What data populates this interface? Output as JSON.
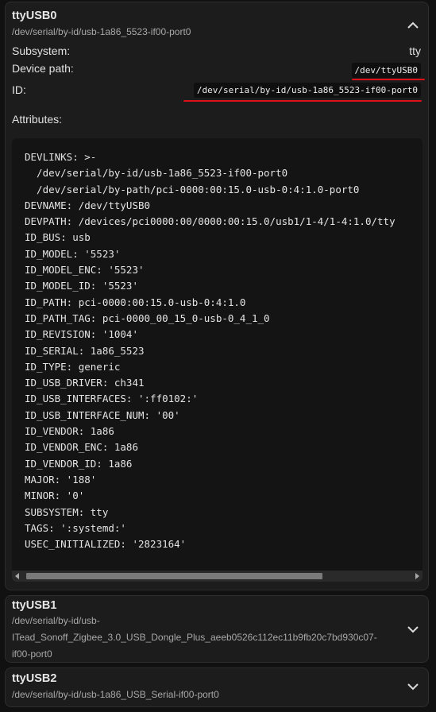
{
  "devices": [
    {
      "title": "ttyUSB0",
      "subtitle": "/dev/serial/by-id/usb-1a86_5523-if00-port0",
      "expanded": true,
      "icon": "chevron-up-icon",
      "subsystem_label": "Subsystem:",
      "subsystem_value": "tty",
      "device_path_label": "Device path:",
      "device_path_value": "/dev/ttyUSB0",
      "id_label": "ID:",
      "id_value": "/dev/serial/by-id/usb-1a86_5523-if00-port0",
      "attributes_label": "Attributes:",
      "attributes": [
        "DEVLINKS: >-",
        "  /dev/serial/by-id/usb-1a86_5523-if00-port0",
        "  /dev/serial/by-path/pci-0000:00:15.0-usb-0:4:1.0-port0",
        "DEVNAME: /dev/ttyUSB0",
        "DEVPATH: /devices/pci0000:00/0000:00:15.0/usb1/1-4/1-4:1.0/tty",
        "ID_BUS: usb",
        "ID_MODEL: '5523'",
        "ID_MODEL_ENC: '5523'",
        "ID_MODEL_ID: '5523'",
        "ID_PATH: pci-0000:00:15.0-usb-0:4:1.0",
        "ID_PATH_TAG: pci-0000_00_15_0-usb-0_4_1_0",
        "ID_REVISION: '1004'",
        "ID_SERIAL: 1a86_5523",
        "ID_TYPE: generic",
        "ID_USB_DRIVER: ch341",
        "ID_USB_INTERFACES: ':ff0102:'",
        "ID_USB_INTERFACE_NUM: '00'",
        "ID_VENDOR: 1a86",
        "ID_VENDOR_ENC: 1a86",
        "ID_VENDOR_ID: 1a86",
        "MAJOR: '188'",
        "MINOR: '0'",
        "SUBSYSTEM: tty",
        "TAGS: ':systemd:'",
        "USEC_INITIALIZED: '2823164'"
      ]
    },
    {
      "title": "ttyUSB1",
      "subtitle_lines": [
        "/dev/serial/by-id/usb-",
        "ITead_Sonoff_Zigbee_3.0_USB_Dongle_Plus_aeeb0526c112ec11b9fb20c7bd930c07-",
        "if00-port0"
      ],
      "expanded": false,
      "icon": "chevron-down-icon"
    },
    {
      "title": "ttyUSB2",
      "subtitle": "/dev/serial/by-id/usb-1a86_USB_Serial-if00-port0",
      "expanded": false,
      "icon": "chevron-down-icon"
    }
  ],
  "colors": {
    "background": "#111111",
    "panel": "#1c1c1c",
    "code_background": "#141414",
    "annotation_underline": "#e01018"
  }
}
